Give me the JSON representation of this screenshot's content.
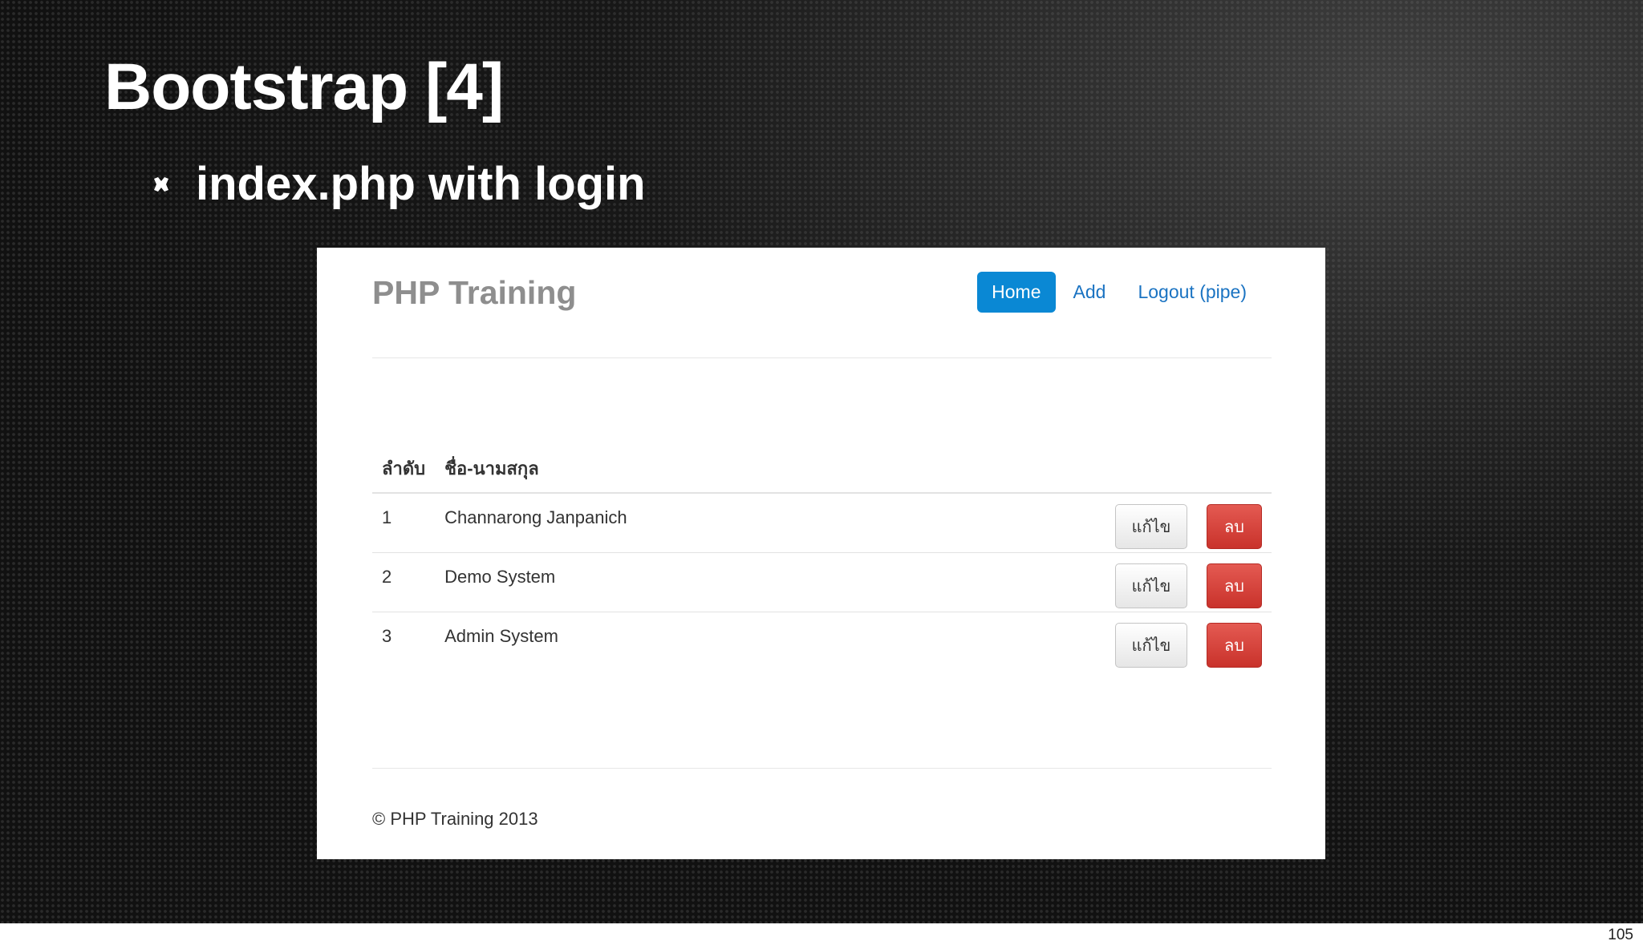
{
  "slide": {
    "title": "Bootstrap [4]",
    "bullet": "index.php with login",
    "page_number": "105"
  },
  "app": {
    "brand": "PHP Training",
    "nav": [
      {
        "label": "Home",
        "active": true
      },
      {
        "label": "Add",
        "active": false
      },
      {
        "label": "Logout (pipe)",
        "active": false
      }
    ],
    "table": {
      "headers": [
        "ลำดับ",
        "ชื่อ-นามสกุล"
      ],
      "rows": [
        {
          "num": "1",
          "name": "Channarong Janpanich",
          "edit": "แก้ไข",
          "delete": "ลบ"
        },
        {
          "num": "2",
          "name": "Demo System",
          "edit": "แก้ไข",
          "delete": "ลบ"
        },
        {
          "num": "3",
          "name": "Admin System",
          "edit": "แก้ไข",
          "delete": "ลบ"
        }
      ]
    },
    "footer": "© PHP Training 2013"
  },
  "colors": {
    "nav_active": "#0a88d4",
    "link": "#1a73c2",
    "danger": "#d9403a",
    "brand_gray": "#8e8e8e"
  }
}
